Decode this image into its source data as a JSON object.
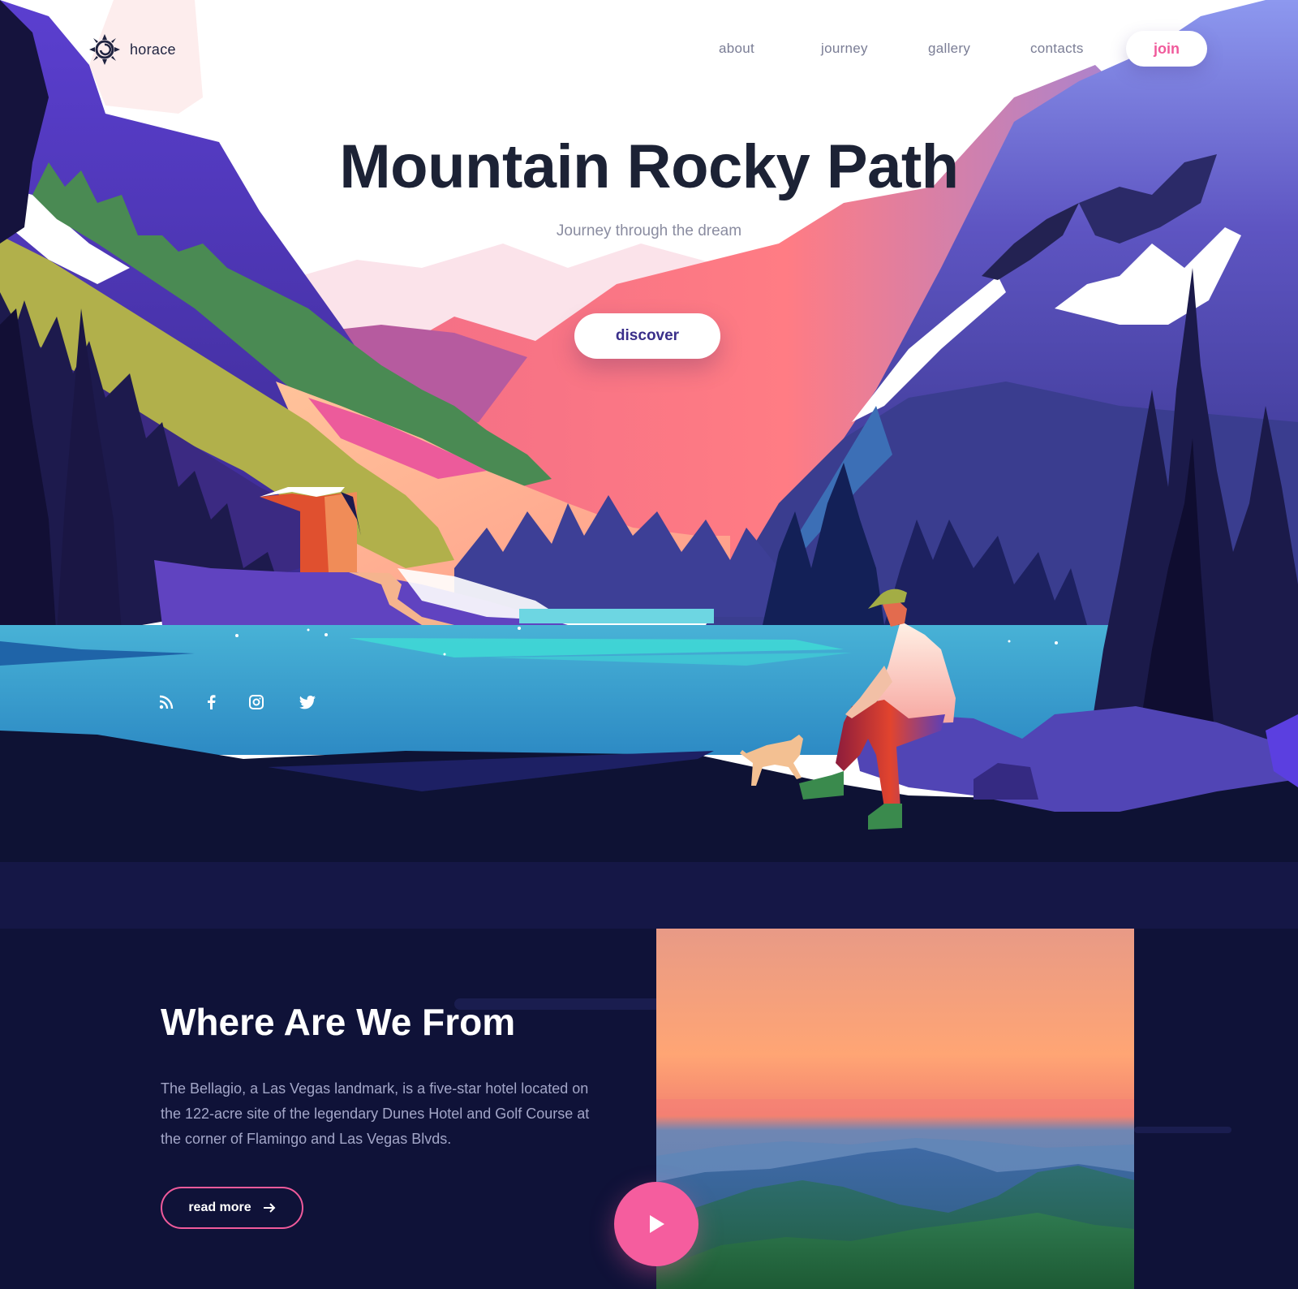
{
  "brand": {
    "name": "horace",
    "logo_icon": "sun-swirl-icon"
  },
  "nav": {
    "items": [
      {
        "label": "about"
      },
      {
        "label": "journey"
      },
      {
        "label": "gallery"
      },
      {
        "label": "contacts"
      }
    ],
    "join_label": "join"
  },
  "hero": {
    "title": "Mountain Rocky Path",
    "subtitle": "Journey through the dream",
    "cta_label": "discover"
  },
  "social": {
    "icons": [
      "rss-icon",
      "facebook-icon",
      "instagram-icon",
      "twitter-icon"
    ]
  },
  "about": {
    "title": "Where Are We From",
    "text": "The Bellagio, a Las Vegas landmark, is a five-star hotel located on the 122-acre site of the legendary Dunes Hotel and Golf Course at the corner of Flamingo and Las Vegas Blvds.",
    "read_more_label": "read more",
    "read_more_icon": "arrow-right-icon",
    "play_icon": "play-icon"
  },
  "colors": {
    "accent": "#f05a9b",
    "dark": "#0f1238",
    "heading": "#1c2235",
    "cta_text": "#3a2f8a"
  }
}
